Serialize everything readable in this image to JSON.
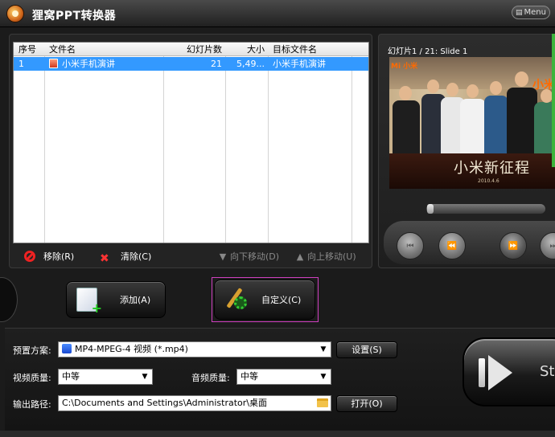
{
  "app": {
    "title": "狸窝PPT转换器",
    "menu_label": "Menu"
  },
  "file_list": {
    "columns": [
      "序号",
      "文件名",
      "幻灯片数",
      "大小",
      "目标文件名"
    ],
    "rows": [
      {
        "index": "1",
        "filename": "小米手机演讲",
        "slides": "21",
        "size": "5,49...",
        "target": "小米手机演讲"
      }
    ]
  },
  "list_toolbar": {
    "remove_label": "移除(R)",
    "clear_label": "清除(C)",
    "move_down_label": "向下移动(D)",
    "move_up_label": "向上移动(U)"
  },
  "preview": {
    "label": "幻灯片1 / 21: Slide 1",
    "slide_logo": "Mi 小米",
    "slide_logo_right": "小米",
    "slide_caption": "小米新征程",
    "slide_date": "2010.4.6"
  },
  "actions": {
    "add_label": "添加(A)",
    "custom_label": "自定义(C)"
  },
  "settings": {
    "preset_label": "预置方案:",
    "preset_value": "MP4-MPEG-4 视频 (*.mp4)",
    "settings_button": "设置(S)",
    "video_quality_label": "视频质量:",
    "video_quality_value": "中等",
    "audio_quality_label": "音频质量:",
    "audio_quality_value": "中等",
    "output_label": "输出路径:",
    "output_path": "C:\\Documents and Settings\\Administrator\\桌面",
    "open_button": "打开(O)"
  },
  "start": {
    "label": "Sta"
  },
  "colors": {
    "selection": "#3399ff",
    "highlight_border": "#d040c0",
    "accent_green": "#3cb43c"
  }
}
